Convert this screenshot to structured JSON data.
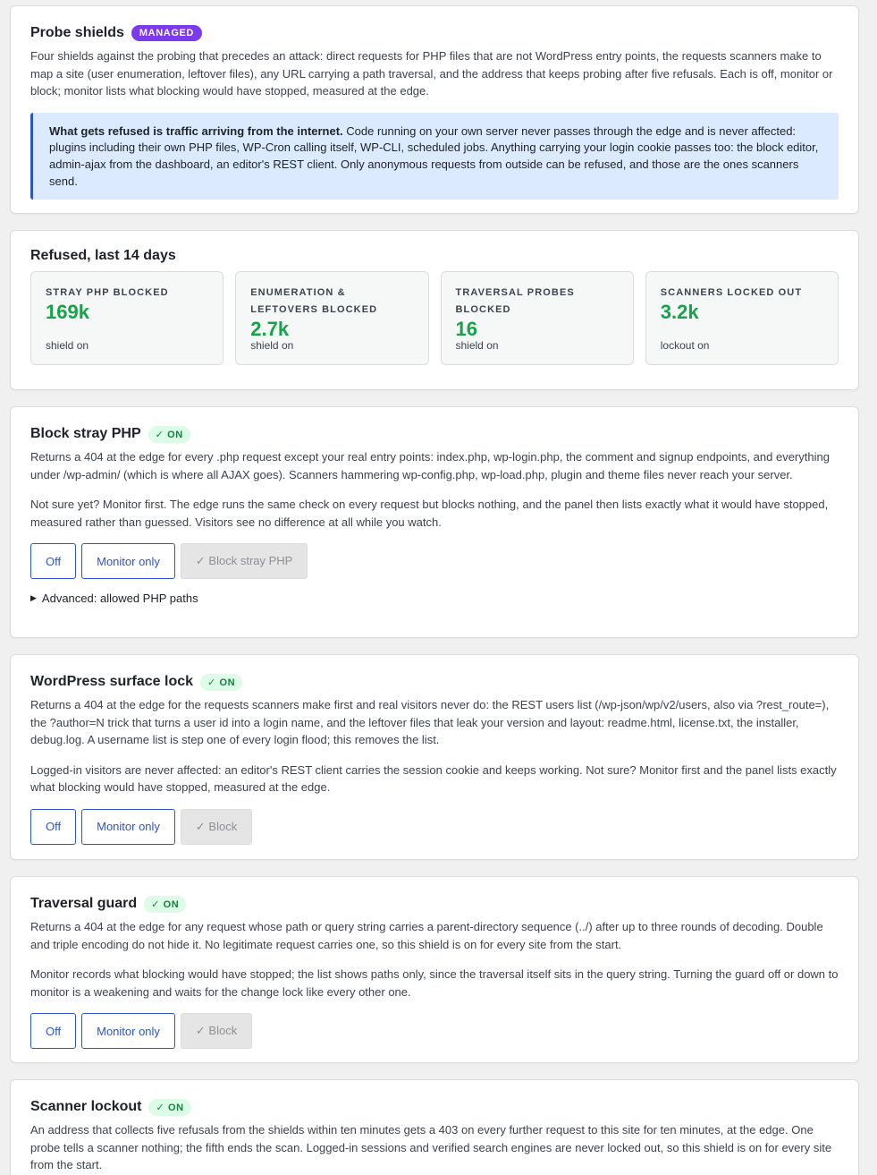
{
  "probe": {
    "title": "Probe shields",
    "badge": "MANAGED",
    "desc": "Four shields against the probing that precedes an attack: direct requests for PHP files that are not WordPress entry points, the requests scanners make to map a site (user enumeration, leftover files), any URL carrying a path traversal, and the address that keeps probing after five refusals. Each is off, monitor or block; monitor lists what blocking would have stopped, measured at the edge.",
    "notice_bold": "What gets refused is traffic arriving from the internet.",
    "notice_text": " Code running on your own server never passes through the edge and is never affected: plugins including their own PHP files, WP-Cron calling itself, WP-CLI, scheduled jobs. Anything carrying your login cookie passes too: the block editor, admin-ajax from the dashboard, an editor's REST client. Only anonymous requests from outside can be refused, and those are the ones scanners send."
  },
  "refused": {
    "title": "Refused, last 14 days",
    "stats": [
      {
        "label": "STRAY PHP BLOCKED",
        "value": "169k",
        "sub": "shield on"
      },
      {
        "label": "ENUMERATION & LEFTOVERS BLOCKED",
        "value": "2.7k",
        "sub": "shield on"
      },
      {
        "label": "TRAVERSAL PROBES BLOCKED",
        "value": "16",
        "sub": "shield on"
      },
      {
        "label": "SCANNERS LOCKED OUT",
        "value": "3.2k",
        "sub": "lockout on"
      }
    ]
  },
  "stray": {
    "title": "Block stray PHP",
    "badge": "✓ ON",
    "desc1": "Returns a 404 at the edge for every .php request except your real entry points: index.php, wp-login.php, the comment and signup endpoints, and everything under /wp-admin/ (which is where all AJAX goes). Scanners hammering wp-config.php, wp-load.php, plugin and theme files never reach your server.",
    "desc2": "Not sure yet? Monitor first. The edge runs the same check on every request but blocks nothing, and the panel then lists exactly what it would have stopped, measured rather than guessed. Visitors see no difference at all while you watch.",
    "btn_off": "Off",
    "btn_monitor": "Monitor only",
    "btn_block": "✓ Block stray PHP",
    "advanced": "Advanced: allowed PHP paths"
  },
  "surface": {
    "title": "WordPress surface lock",
    "badge": "✓ ON",
    "desc1": "Returns a 404 at the edge for the requests scanners make first and real visitors never do: the REST users list (/wp-json/wp/v2/users, also via ?rest_route=), the ?author=N trick that turns a user id into a login name, and the leftover files that leak your version and layout: readme.html, license.txt, the installer, debug.log. A username list is step one of every login flood; this removes the list.",
    "desc2": "Logged-in visitors are never affected: an editor's REST client carries the session cookie and keeps working. Not sure? Monitor first and the panel lists exactly what blocking would have stopped, measured at the edge.",
    "btn_off": "Off",
    "btn_monitor": "Monitor only",
    "btn_block": "✓ Block"
  },
  "traversal": {
    "title": "Traversal guard",
    "badge": "✓ ON",
    "desc1": "Returns a 404 at the edge for any request whose path or query string carries a parent-directory sequence (../) after up to three rounds of decoding. Double and triple encoding do not hide it. No legitimate request carries one, so this shield is on for every site from the start.",
    "desc2": "Monitor records what blocking would have stopped; the list shows paths only, since the traversal itself sits in the query string. Turning the guard off or down to monitor is a weakening and waits for the change lock like every other one.",
    "btn_off": "Off",
    "btn_monitor": "Monitor only",
    "btn_block": "✓ Block"
  },
  "scanner": {
    "title": "Scanner lockout",
    "badge": "✓ ON",
    "desc1": "An address that collects five refusals from the shields within ten minutes gets a 403 on every further request to this site for ten minutes, at the edge. One probe tells a scanner nothing; the fifth ends the scan. Logged-in sessions and verified search engines are never locked out, so this shield is on for every site from the start."
  },
  "colors": {
    "accent": "#2c56c9",
    "managed": "#7c3aed",
    "on_badge_bg": "#dcfce7",
    "on_badge_text": "#15803d",
    "stat_value": "#16a34a",
    "notice_bg": "#dbeafe"
  }
}
